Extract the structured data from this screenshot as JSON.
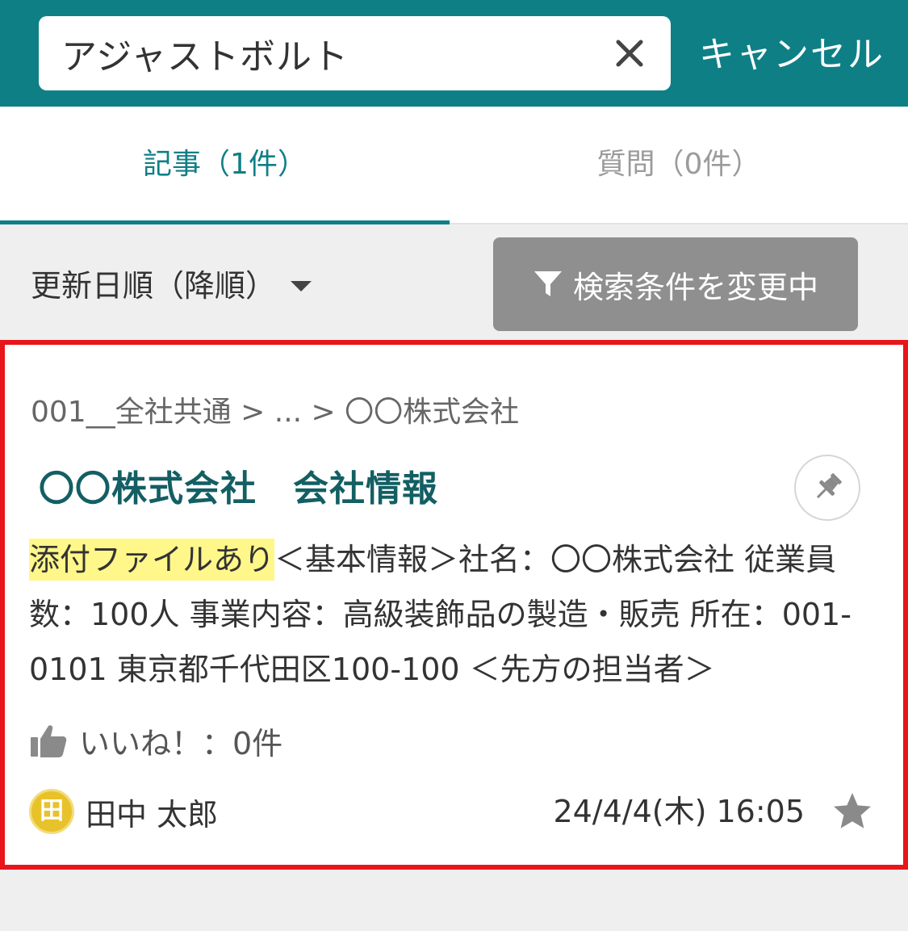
{
  "search": {
    "query": "アジャストボルト",
    "cancel_label": "キャンセル"
  },
  "tabs": [
    {
      "label": "記事（1件）",
      "active": true
    },
    {
      "label": "質問（0件）",
      "active": false
    }
  ],
  "toolbar": {
    "sort_label": "更新日順（降順）",
    "filter_label": "検索条件を変更中"
  },
  "article": {
    "breadcrumb": "001__全社共通 > ... > 〇〇株式会社",
    "title": "〇〇株式会社　会社情報",
    "attachment_badge": "添付ファイルあり",
    "excerpt": "＜基本情報＞社名：〇〇株式会社 従業員数：100人 事業内容：高級装飾品の製造・販売 所在：001-0101 東京都千代田区100-100 ＜先方の担当者＞",
    "likes_label": "いいね！：0件",
    "author_initial": "田",
    "author_name": "田中 太郎",
    "timestamp": "24/4/4(木) 16:05"
  },
  "colors": {
    "brand": "#0f7f86",
    "title": "#135f63",
    "highlight": "#fff78a",
    "selection_border": "#e8151b",
    "filter_button": "#8f8f8f",
    "avatar": "#e8c22b"
  }
}
